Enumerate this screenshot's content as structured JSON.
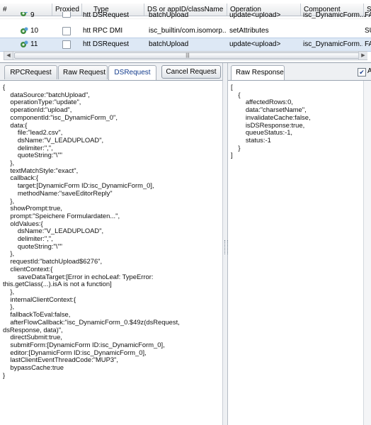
{
  "grid": {
    "columns": [
      "#",
      "Proxied",
      "Type",
      "DS or appID/className",
      "Operation",
      "Component",
      "St"
    ],
    "rows": [
      {
        "num": "9",
        "type": "htt DSRequest",
        "ds": "batchUpload",
        "operation": "update<upload>",
        "component": "isc_DynamicForm...",
        "status": "FA",
        "selected": false
      },
      {
        "num": "10",
        "type": "htt RPC DMI",
        "ds": "isc_builtin/com.isomorp...",
        "operation": "setAttributes",
        "component": "",
        "status": "SU",
        "selected": false
      },
      {
        "num": "11",
        "type": "htt DSRequest",
        "ds": "batchUpload",
        "operation": "update<upload>",
        "component": "isc_DynamicForm...",
        "status": "FA",
        "selected": true
      }
    ],
    "scroll_grip": "|||"
  },
  "tabs": {
    "rpc_request": "RPCRequest",
    "raw_request": "Raw Request",
    "ds_request": "DSRequest",
    "cancel_request": "Cancel Request",
    "raw_response": "Raw Response",
    "auto_label": "A"
  },
  "request_text": "{\n    dataSource:\"batchUpload\",\n    operationType:\"update\",\n    operationId:\"upload\",\n    componentId:\"isc_DynamicForm_0\",\n    data:{\n        file:\"lead2.csv\",\n        dsName:\"V_LEADUPLOAD\",\n        delimiter:\",\",\n        quoteString:\"\\\"\"\n    },\n    textMatchStyle:\"exact\",\n    callback:{\n        target:[DynamicForm ID:isc_DynamicForm_0],\n        methodName:\"saveEditorReply\"\n    },\n    showPrompt:true,\n    prompt:\"Speichere Formulardaten...\",\n    oldValues:{\n        dsName:\"V_LEADUPLOAD\",\n        delimiter:\",\",\n        quoteString:\"\\\"\"\n    },\n    requestId:\"batchUpload$6276\",\n    clientContext:{\n        saveDataTarget:[Error in echoLeaf: TypeError:\nthis.getClass(...).isA is not a function]\n    },\n    internalClientContext:{\n    },\n    fallbackToEval:false,\n    afterFlowCallback:\"isc_DynamicForm_0.$49z(dsRequest,\ndsResponse, data)\",\n    directSubmit:true,\n    submitForm:[DynamicForm ID:isc_DynamicForm_0],\n    editor:[DynamicForm ID:isc_DynamicForm_0],\n    lastClientEventThreadCode:\"MUP3\",\n    bypassCache:true\n}",
  "response_text": "[\n    {\n        affectedRows:0,\n        data:\"charsetName\",\n        invalidateCache:false,\n        isDSResponse:true,\n        queueStatus:-1,\n        status:-1\n    }\n]",
  "colors": {
    "selected_row": "#dde8f5",
    "active_tab_text": "#123b8c",
    "border": "#9aa4b0"
  }
}
